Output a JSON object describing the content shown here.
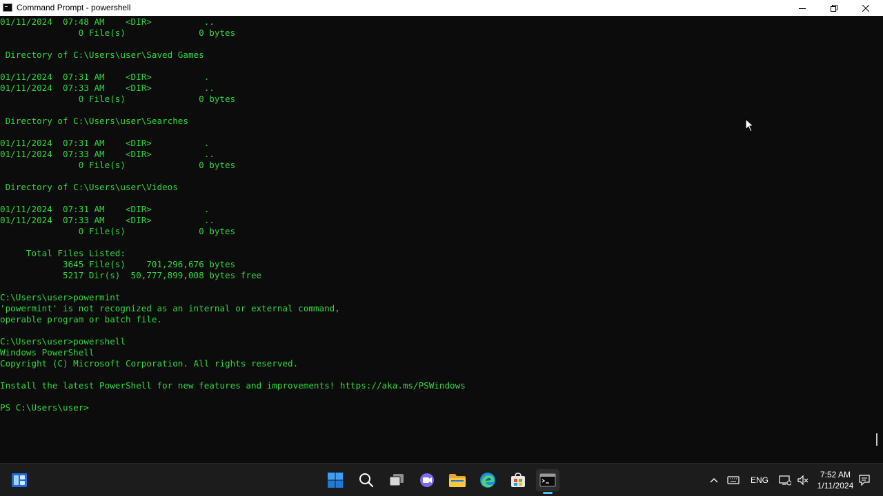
{
  "window": {
    "title": "Command Prompt - powershell"
  },
  "console": {
    "text_color": "#31d63f",
    "background": "#0c0c0c",
    "lines": [
      "01/11/2024  07:48 AM    <DIR>          ..",
      "               0 File(s)              0 bytes",
      "",
      " Directory of C:\\Users\\user\\Saved Games",
      "",
      "01/11/2024  07:31 AM    <DIR>          .",
      "01/11/2024  07:33 AM    <DIR>          ..",
      "               0 File(s)              0 bytes",
      "",
      " Directory of C:\\Users\\user\\Searches",
      "",
      "01/11/2024  07:31 AM    <DIR>          .",
      "01/11/2024  07:33 AM    <DIR>          ..",
      "               0 File(s)              0 bytes",
      "",
      " Directory of C:\\Users\\user\\Videos",
      "",
      "01/11/2024  07:31 AM    <DIR>          .",
      "01/11/2024  07:33 AM    <DIR>          ..",
      "               0 File(s)              0 bytes",
      "",
      "     Total Files Listed:",
      "            3645 File(s)    701,296,676 bytes",
      "            5217 Dir(s)  50,777,899,008 bytes free",
      "",
      "C:\\Users\\user>powermint",
      "'powermint' is not recognized as an internal or external command,",
      "operable program or batch file.",
      "",
      "C:\\Users\\user>powershell",
      "Windows PowerShell",
      "Copyright (C) Microsoft Corporation. All rights reserved.",
      "",
      "Install the latest PowerShell for new features and improvements! https://aka.ms/PSWindows",
      "",
      "PS C:\\Users\\user>"
    ]
  },
  "taskbar": {
    "icons": [
      "widgets-icon",
      "start-icon",
      "search-icon",
      "task-view-icon",
      "chat-icon",
      "file-explorer-icon",
      "edge-icon",
      "store-icon",
      "terminal-icon"
    ],
    "accent": "#4cc2ff",
    "tray": {
      "language": "ENG",
      "time": "7:52 AM",
      "date": "1/11/2024"
    }
  }
}
